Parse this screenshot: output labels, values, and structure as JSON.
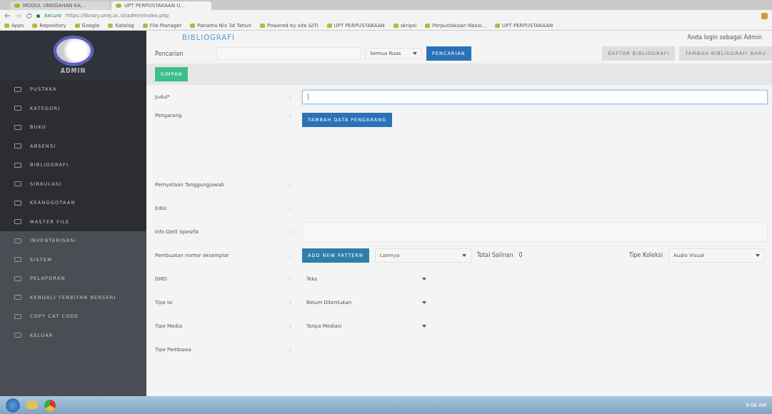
{
  "browser": {
    "tabs": [
      {
        "label": "MODUL UNGGAHAN KA...",
        "selected": false
      },
      {
        "label": "UPT PERPUSTAKAAN U...",
        "selected": true
      }
    ],
    "address": {
      "secure_label": "Secure",
      "url": "https://library.unej.ac.id/admin/index.php"
    },
    "bookmarks": [
      "Apps",
      "Repository",
      "Google",
      "Katalog",
      "File Manager",
      "Panama Nix 3d Tahun",
      "Powered by site &ITI",
      "UPT PERPUSTAKAAN",
      "skripsi",
      "Perpustakaan Nasio...",
      "UPT PERPUSTAKAAN"
    ]
  },
  "sidebar": {
    "user": "ADMIN",
    "sections": [
      {
        "items": [
          "PUSTAKA",
          "KATEGORI",
          "BUKU",
          "ABSENSI",
          "BIBLIOGRAFI",
          "SIRKULASI",
          "KEANGGOTAAN",
          "MASTER FILE"
        ]
      },
      {
        "items": [
          "INVENTARISASI",
          "SISTEM",
          "PELAPORAN",
          "KENDALI TERBITAN BERSERI",
          "COPY CAT CODE",
          "KELUAR"
        ]
      }
    ]
  },
  "header": {
    "title": "BIBLIOGRAFI",
    "login": "Anda login sebagai Admin"
  },
  "search": {
    "label": "Pencarian",
    "scope": "Semua Ruas",
    "button": "PENCARIAN"
  },
  "actions": [
    "DAFTAR BIBLIOGRAFI",
    "TAMBAH BIBLIOGRAFI BARU"
  ],
  "save_button": "SIMPAN",
  "form": [
    {
      "kind": "input",
      "label": "Judul*",
      "separator": ":",
      "value": "|"
    },
    {
      "kind": "button",
      "label": "Pengarang",
      "separator": ":",
      "button": "TAMBAH DATA PENGARANG"
    },
    {
      "kind": "blank",
      "label": "Pernyataan Tanggungjawab",
      "separator": ":"
    },
    {
      "kind": "blank",
      "label": "Edisi",
      "separator": ":"
    },
    {
      "kind": "textarea",
      "label": "Info Detil Spesifik",
      "separator": ":"
    },
    {
      "kind": "pattern",
      "label": "Pembuatan nomor eksemplar",
      "separator": ":",
      "button": "ADD NEW PATTERN",
      "pattern": "Lainnya",
      "total_label": "Total Salinan",
      "total": "0",
      "type_label": "Tipe Koleksi",
      "type": "Audio Visual"
    },
    {
      "kind": "select",
      "label": "GMD",
      "separator": ":",
      "value": "Teks"
    },
    {
      "kind": "select",
      "label": "Tipe Isi",
      "separator": ":",
      "value": "Belum Ditentukan"
    },
    {
      "kind": "select",
      "label": "Tipe Media",
      "separator": ":",
      "value": "Tanpa Mediasi"
    },
    {
      "kind": "blank",
      "label": "Tipe Pembawa",
      "separator": ":"
    }
  ],
  "taskbar": {
    "time": "9:08 AM"
  }
}
